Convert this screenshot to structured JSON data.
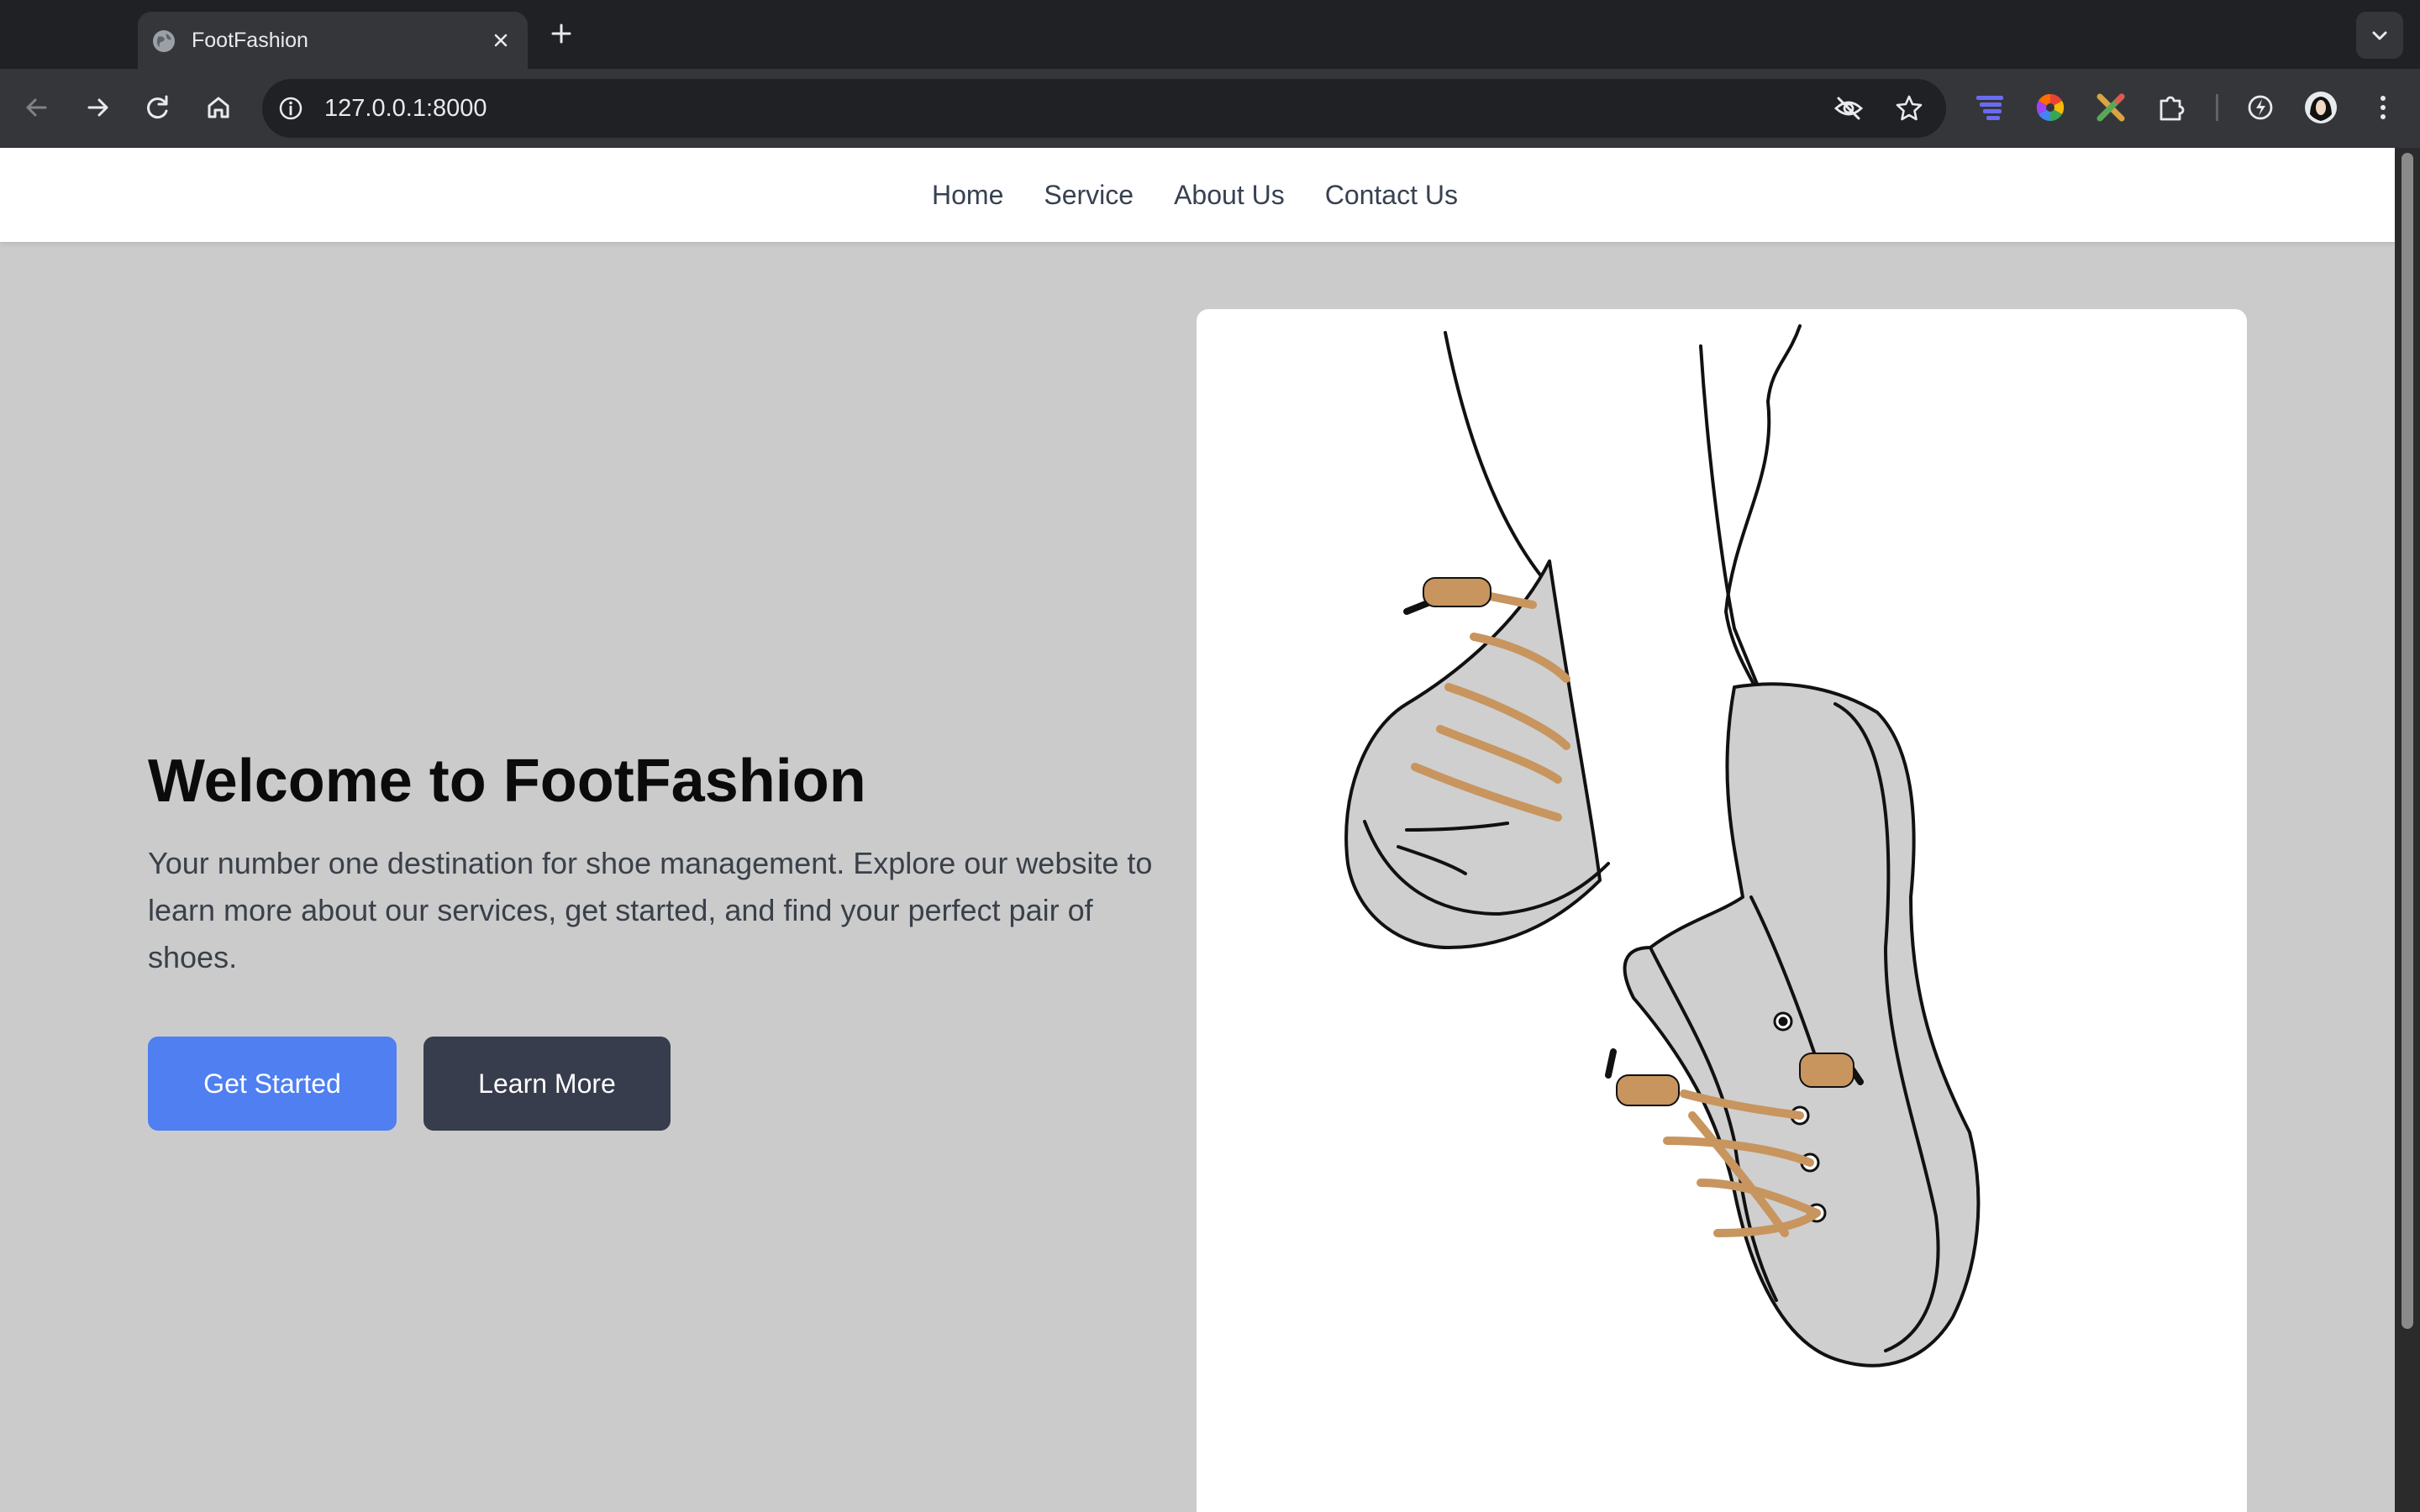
{
  "browser": {
    "tab_title": "FootFashion",
    "url": "127.0.0.1:8000"
  },
  "icons": {
    "tab_favicon": "globe-icon",
    "tab_close": "close-icon",
    "new_tab": "plus-icon",
    "tab_search": "chevron-down-icon",
    "back": "arrow-left-icon",
    "forward": "arrow-right-icon",
    "reload": "reload-icon",
    "home": "home-icon",
    "site_info": "info-icon",
    "tracking": "eye-off-icon",
    "bookmark": "star-icon",
    "extensions": [
      "menu-stack-icon",
      "color-wheel-icon",
      "cross-tools-icon",
      "puzzle-icon",
      "sync-icon",
      "avatar-icon",
      "more-vertical-icon"
    ]
  },
  "nav": {
    "items": [
      {
        "label": "Home"
      },
      {
        "label": "Service"
      },
      {
        "label": "About Us"
      },
      {
        "label": "Contact Us"
      }
    ]
  },
  "hero": {
    "title": "Welcome to FootFashion",
    "description": "Your number one destination for shoe management. Explore our website to learn more about our services, get started, and find your perfect pair of shoes.",
    "primary_button": "Get Started",
    "secondary_button": "Learn More"
  },
  "colors": {
    "page_bg": "#cbcbcb",
    "primary_button": "#4f7ff0",
    "secondary_button": "#373d4c",
    "shoe_fill": "#cfcfcf",
    "laces": "#c8955e"
  }
}
